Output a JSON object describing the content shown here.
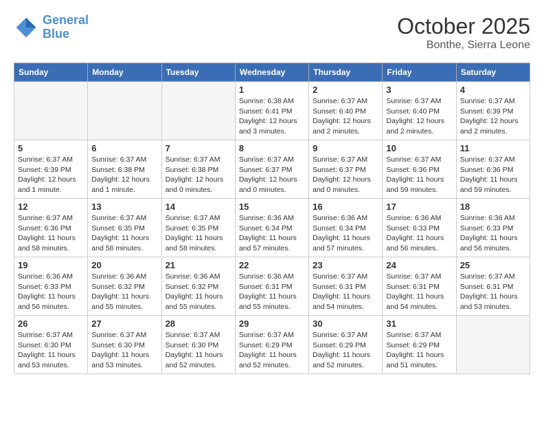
{
  "header": {
    "logo_line1": "General",
    "logo_line2": "Blue",
    "month": "October 2025",
    "location": "Bonthe, Sierra Leone"
  },
  "weekdays": [
    "Sunday",
    "Monday",
    "Tuesday",
    "Wednesday",
    "Thursday",
    "Friday",
    "Saturday"
  ],
  "weeks": [
    [
      {
        "day": "",
        "info": ""
      },
      {
        "day": "",
        "info": ""
      },
      {
        "day": "",
        "info": ""
      },
      {
        "day": "1",
        "info": "Sunrise: 6:38 AM\nSunset: 6:41 PM\nDaylight: 12 hours\nand 3 minutes."
      },
      {
        "day": "2",
        "info": "Sunrise: 6:37 AM\nSunset: 6:40 PM\nDaylight: 12 hours\nand 2 minutes."
      },
      {
        "day": "3",
        "info": "Sunrise: 6:37 AM\nSunset: 6:40 PM\nDaylight: 12 hours\nand 2 minutes."
      },
      {
        "day": "4",
        "info": "Sunrise: 6:37 AM\nSunset: 6:39 PM\nDaylight: 12 hours\nand 2 minutes."
      }
    ],
    [
      {
        "day": "5",
        "info": "Sunrise: 6:37 AM\nSunset: 6:39 PM\nDaylight: 12 hours\nand 1 minute."
      },
      {
        "day": "6",
        "info": "Sunrise: 6:37 AM\nSunset: 6:38 PM\nDaylight: 12 hours\nand 1 minute."
      },
      {
        "day": "7",
        "info": "Sunrise: 6:37 AM\nSunset: 6:38 PM\nDaylight: 12 hours\nand 0 minutes."
      },
      {
        "day": "8",
        "info": "Sunrise: 6:37 AM\nSunset: 6:37 PM\nDaylight: 12 hours\nand 0 minutes."
      },
      {
        "day": "9",
        "info": "Sunrise: 6:37 AM\nSunset: 6:37 PM\nDaylight: 12 hours\nand 0 minutes."
      },
      {
        "day": "10",
        "info": "Sunrise: 6:37 AM\nSunset: 6:36 PM\nDaylight: 11 hours\nand 59 minutes."
      },
      {
        "day": "11",
        "info": "Sunrise: 6:37 AM\nSunset: 6:36 PM\nDaylight: 11 hours\nand 59 minutes."
      }
    ],
    [
      {
        "day": "12",
        "info": "Sunrise: 6:37 AM\nSunset: 6:36 PM\nDaylight: 11 hours\nand 58 minutes."
      },
      {
        "day": "13",
        "info": "Sunrise: 6:37 AM\nSunset: 6:35 PM\nDaylight: 11 hours\nand 58 minutes."
      },
      {
        "day": "14",
        "info": "Sunrise: 6:37 AM\nSunset: 6:35 PM\nDaylight: 11 hours\nand 58 minutes."
      },
      {
        "day": "15",
        "info": "Sunrise: 6:36 AM\nSunset: 6:34 PM\nDaylight: 11 hours\nand 57 minutes."
      },
      {
        "day": "16",
        "info": "Sunrise: 6:36 AM\nSunset: 6:34 PM\nDaylight: 11 hours\nand 57 minutes."
      },
      {
        "day": "17",
        "info": "Sunrise: 6:36 AM\nSunset: 6:33 PM\nDaylight: 11 hours\nand 56 minutes."
      },
      {
        "day": "18",
        "info": "Sunrise: 6:36 AM\nSunset: 6:33 PM\nDaylight: 11 hours\nand 56 minutes."
      }
    ],
    [
      {
        "day": "19",
        "info": "Sunrise: 6:36 AM\nSunset: 6:33 PM\nDaylight: 11 hours\nand 56 minutes."
      },
      {
        "day": "20",
        "info": "Sunrise: 6:36 AM\nSunset: 6:32 PM\nDaylight: 11 hours\nand 55 minutes."
      },
      {
        "day": "21",
        "info": "Sunrise: 6:36 AM\nSunset: 6:32 PM\nDaylight: 11 hours\nand 55 minutes."
      },
      {
        "day": "22",
        "info": "Sunrise: 6:36 AM\nSunset: 6:31 PM\nDaylight: 11 hours\nand 55 minutes."
      },
      {
        "day": "23",
        "info": "Sunrise: 6:37 AM\nSunset: 6:31 PM\nDaylight: 11 hours\nand 54 minutes."
      },
      {
        "day": "24",
        "info": "Sunrise: 6:37 AM\nSunset: 6:31 PM\nDaylight: 11 hours\nand 54 minutes."
      },
      {
        "day": "25",
        "info": "Sunrise: 6:37 AM\nSunset: 6:31 PM\nDaylight: 11 hours\nand 53 minutes."
      }
    ],
    [
      {
        "day": "26",
        "info": "Sunrise: 6:37 AM\nSunset: 6:30 PM\nDaylight: 11 hours\nand 53 minutes."
      },
      {
        "day": "27",
        "info": "Sunrise: 6:37 AM\nSunset: 6:30 PM\nDaylight: 11 hours\nand 53 minutes."
      },
      {
        "day": "28",
        "info": "Sunrise: 6:37 AM\nSunset: 6:30 PM\nDaylight: 11 hours\nand 52 minutes."
      },
      {
        "day": "29",
        "info": "Sunrise: 6:37 AM\nSunset: 6:29 PM\nDaylight: 11 hours\nand 52 minutes."
      },
      {
        "day": "30",
        "info": "Sunrise: 6:37 AM\nSunset: 6:29 PM\nDaylight: 11 hours\nand 52 minutes."
      },
      {
        "day": "31",
        "info": "Sunrise: 6:37 AM\nSunset: 6:29 PM\nDaylight: 11 hours\nand 51 minutes."
      },
      {
        "day": "",
        "info": ""
      }
    ]
  ]
}
